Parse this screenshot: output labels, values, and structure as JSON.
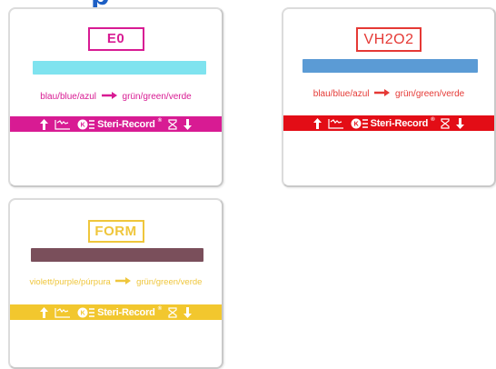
{
  "cropped_heading": "p",
  "cards": [
    {
      "label": "E0",
      "color_line_left": "blau/blue/azul",
      "color_line_right": "grün/green/verde",
      "brand": "Steri-Record",
      "colors": {
        "accent": "#d81b93",
        "bar": "#7fe3ef",
        "strip": "#d81b93"
      },
      "icons": [
        "up-arrow",
        "temperature-graph",
        "steri-record-logo",
        "hourglass",
        "down-arrow"
      ]
    },
    {
      "label": "VH2O2",
      "color_line_left": "blau/blue/azul",
      "color_line_right": "grün/green/verde",
      "brand": "Steri-Record",
      "colors": {
        "accent": "#e53935",
        "bar": "#5b9bd5",
        "strip": "#e30d16"
      },
      "icons": [
        "up-arrow",
        "temperature-graph",
        "steri-record-logo",
        "hourglass",
        "down-arrow"
      ]
    },
    {
      "label": "FORM",
      "color_line_left": "violett/purple/púrpura",
      "color_line_right": "grün/green/verde",
      "brand": "Steri-Record",
      "colors": {
        "accent": "#efc63c",
        "bar": "#7a4f5b",
        "strip": "#f2c72e"
      },
      "icons": [
        "up-arrow",
        "temperature-graph",
        "steri-record-logo",
        "hourglass",
        "down-arrow"
      ]
    }
  ]
}
